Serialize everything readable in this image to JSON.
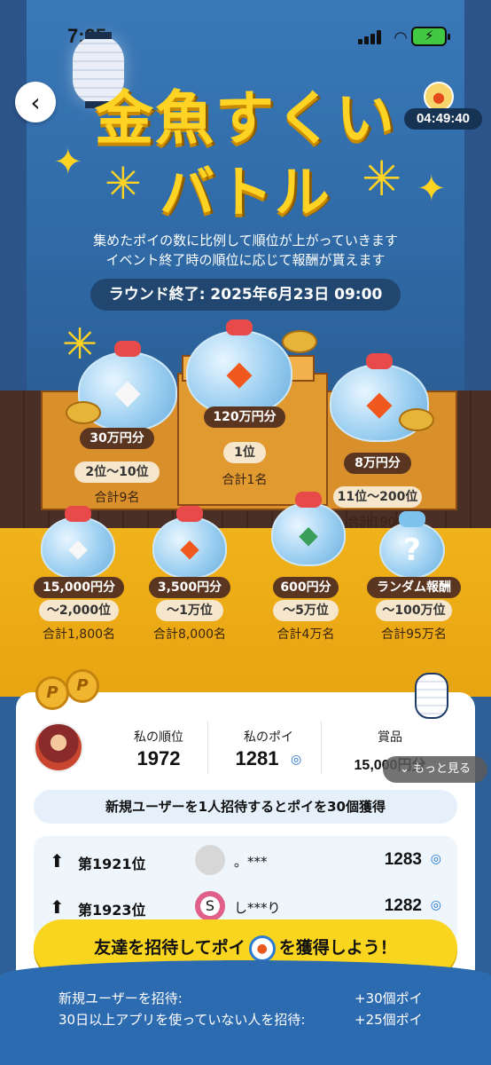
{
  "status_bar": {
    "time": "7:25"
  },
  "header": {
    "back_label": "‹",
    "timer": "04:49:40",
    "title_line1": "金魚すくい",
    "title_line2": "バトル",
    "description_line1": "集めたポイの数に比例して順位が上がっていきます",
    "description_line2": "イベント終了時の順位に応じて報酬が貰えます",
    "round_end": "ラウンド終了: 2025年6月23日 09:00"
  },
  "prizes": [
    {
      "amount": "120万円分",
      "rank": "1位",
      "total": "合計1名"
    },
    {
      "amount": "30万円分",
      "rank": "2位〜10位",
      "total": "合計9名"
    },
    {
      "amount": "8万円分",
      "rank": "11位〜200位",
      "total": "合計190名"
    },
    {
      "amount": "15,000円分",
      "rank": "〜2,000位",
      "total": "合計1,800名"
    },
    {
      "amount": "3,500円分",
      "rank": "〜1万位",
      "total": "合計8,000名"
    },
    {
      "amount": "600円分",
      "rank": "〜5万位",
      "total": "合計4万名"
    },
    {
      "amount": "ランダム報酬",
      "rank": "〜100万位",
      "total": "合計95万名"
    }
  ],
  "my_stats": {
    "rank_label": "私の順位",
    "rank_value": "1972",
    "poi_label": "私のポイ",
    "poi_value": "1281",
    "prize_label": "賞品",
    "prize_value": "15,000円分",
    "more_label": "もっと見る"
  },
  "invite_bar": "新規ユーザーを1人招待するとポイを30個獲得",
  "leaderboard": [
    {
      "rank": "第1921位",
      "name": "。***",
      "points": "1283"
    },
    {
      "rank": "第1923位",
      "name": "し***り",
      "points": "1282"
    }
  ],
  "cta": {
    "label_before": "友達を招待してポイ",
    "label_after": "を獲得しよう！"
  },
  "footer": {
    "row1_label": "新規ユーザーを招待:",
    "row1_value": "+30個ポイ",
    "row2_label": "30日以上アプリを使っていない人を招待:",
    "row2_value": "+25個ポイ"
  },
  "colors": {
    "accent_yellow": "#ffd324",
    "stage_wood": "#d9902b",
    "floor_gold": "#f0b21a",
    "cta": "#f9d51f"
  }
}
